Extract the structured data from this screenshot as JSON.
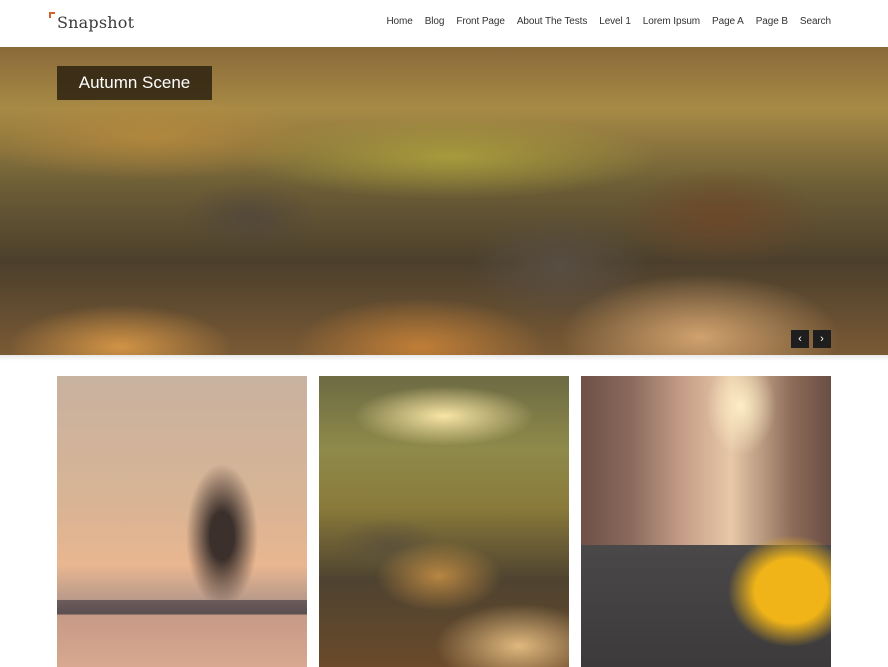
{
  "site": {
    "title": "Snapshot",
    "logo_icon": "corner-bracket-icon"
  },
  "nav": {
    "items": [
      {
        "label": "Home"
      },
      {
        "label": "Blog"
      },
      {
        "label": "Front Page"
      },
      {
        "label": "About The Tests"
      },
      {
        "label": "Level 1"
      },
      {
        "label": "Lorem Ipsum"
      },
      {
        "label": "Page A"
      },
      {
        "label": "Page B"
      },
      {
        "label": "Search"
      }
    ]
  },
  "hero": {
    "caption": "Autumn Scene",
    "image_description": "Close-up of fallen autumn leaves on grass",
    "prev_icon": "‹",
    "next_icon": "›"
  },
  "gallery": {
    "tiles": [
      {
        "description": "Bare tree in snow with park bench at sunset"
      },
      {
        "description": "Autumn leaves on grass with sunlight"
      },
      {
        "description": "City street with yellow taxi cab in sunlight"
      }
    ]
  },
  "colors": {
    "accent": "#d2622a",
    "text": "#333333",
    "caption_bg": "#281e0f",
    "arrow_bg": "#1e1e1e"
  }
}
